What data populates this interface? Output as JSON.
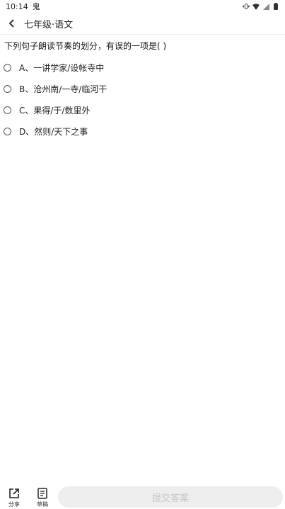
{
  "status_bar": {
    "time": "10:14",
    "notification_glyph": "鬼"
  },
  "header": {
    "title": "七年级·语文"
  },
  "question": {
    "text": "下列句子朗读节奏的划分，有误的一项是(    )",
    "options": [
      {
        "label": "A、一讲学家/设帐寺中"
      },
      {
        "label": "B、沧州南/一寺/临河干"
      },
      {
        "label": "C、果得/于/数里外"
      },
      {
        "label": "D、然则/天下之事"
      }
    ]
  },
  "bottom_bar": {
    "share_label": "分享",
    "draft_label": "草稿",
    "submit_label": "提交答案"
  }
}
